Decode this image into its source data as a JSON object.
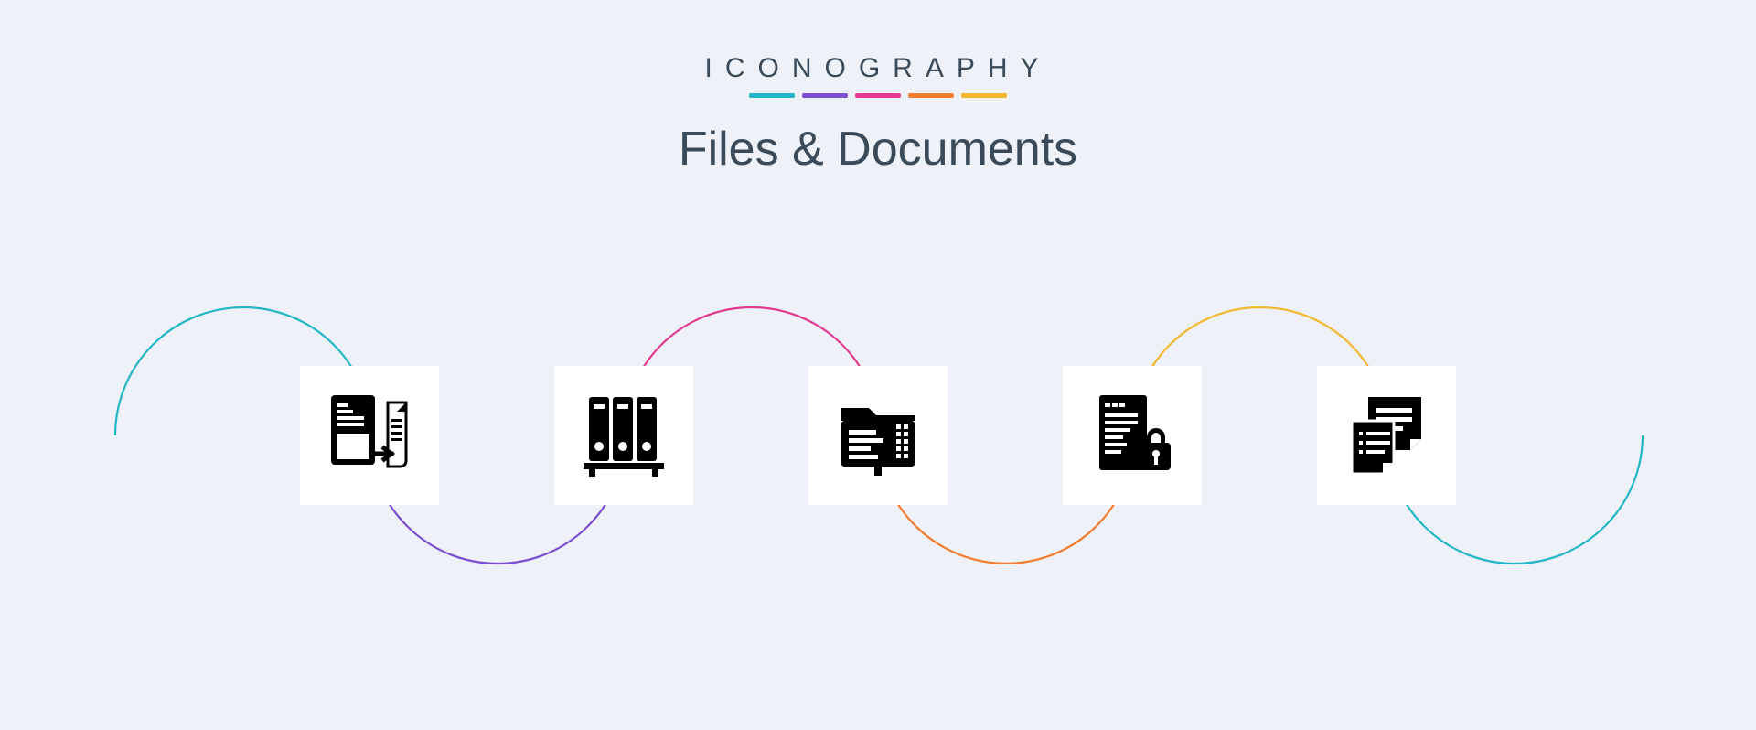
{
  "header": {
    "brand": "ICONOGRAPHY",
    "title": "Files & Documents"
  },
  "colors": {
    "teal": "#23b6c7",
    "purple": "#7a4fd1",
    "magenta": "#e23a8f",
    "orange": "#f27d2f",
    "amber": "#f2b82f",
    "bg": "#eef1f7",
    "card": "#ffffff",
    "glyph": "#000000",
    "text": "#3a4a5a"
  },
  "icons": [
    {
      "name": "document-export-icon"
    },
    {
      "name": "binders-shelf-icon"
    },
    {
      "name": "folder-document-icon"
    },
    {
      "name": "document-lock-icon"
    },
    {
      "name": "sticky-notes-icon"
    }
  ]
}
